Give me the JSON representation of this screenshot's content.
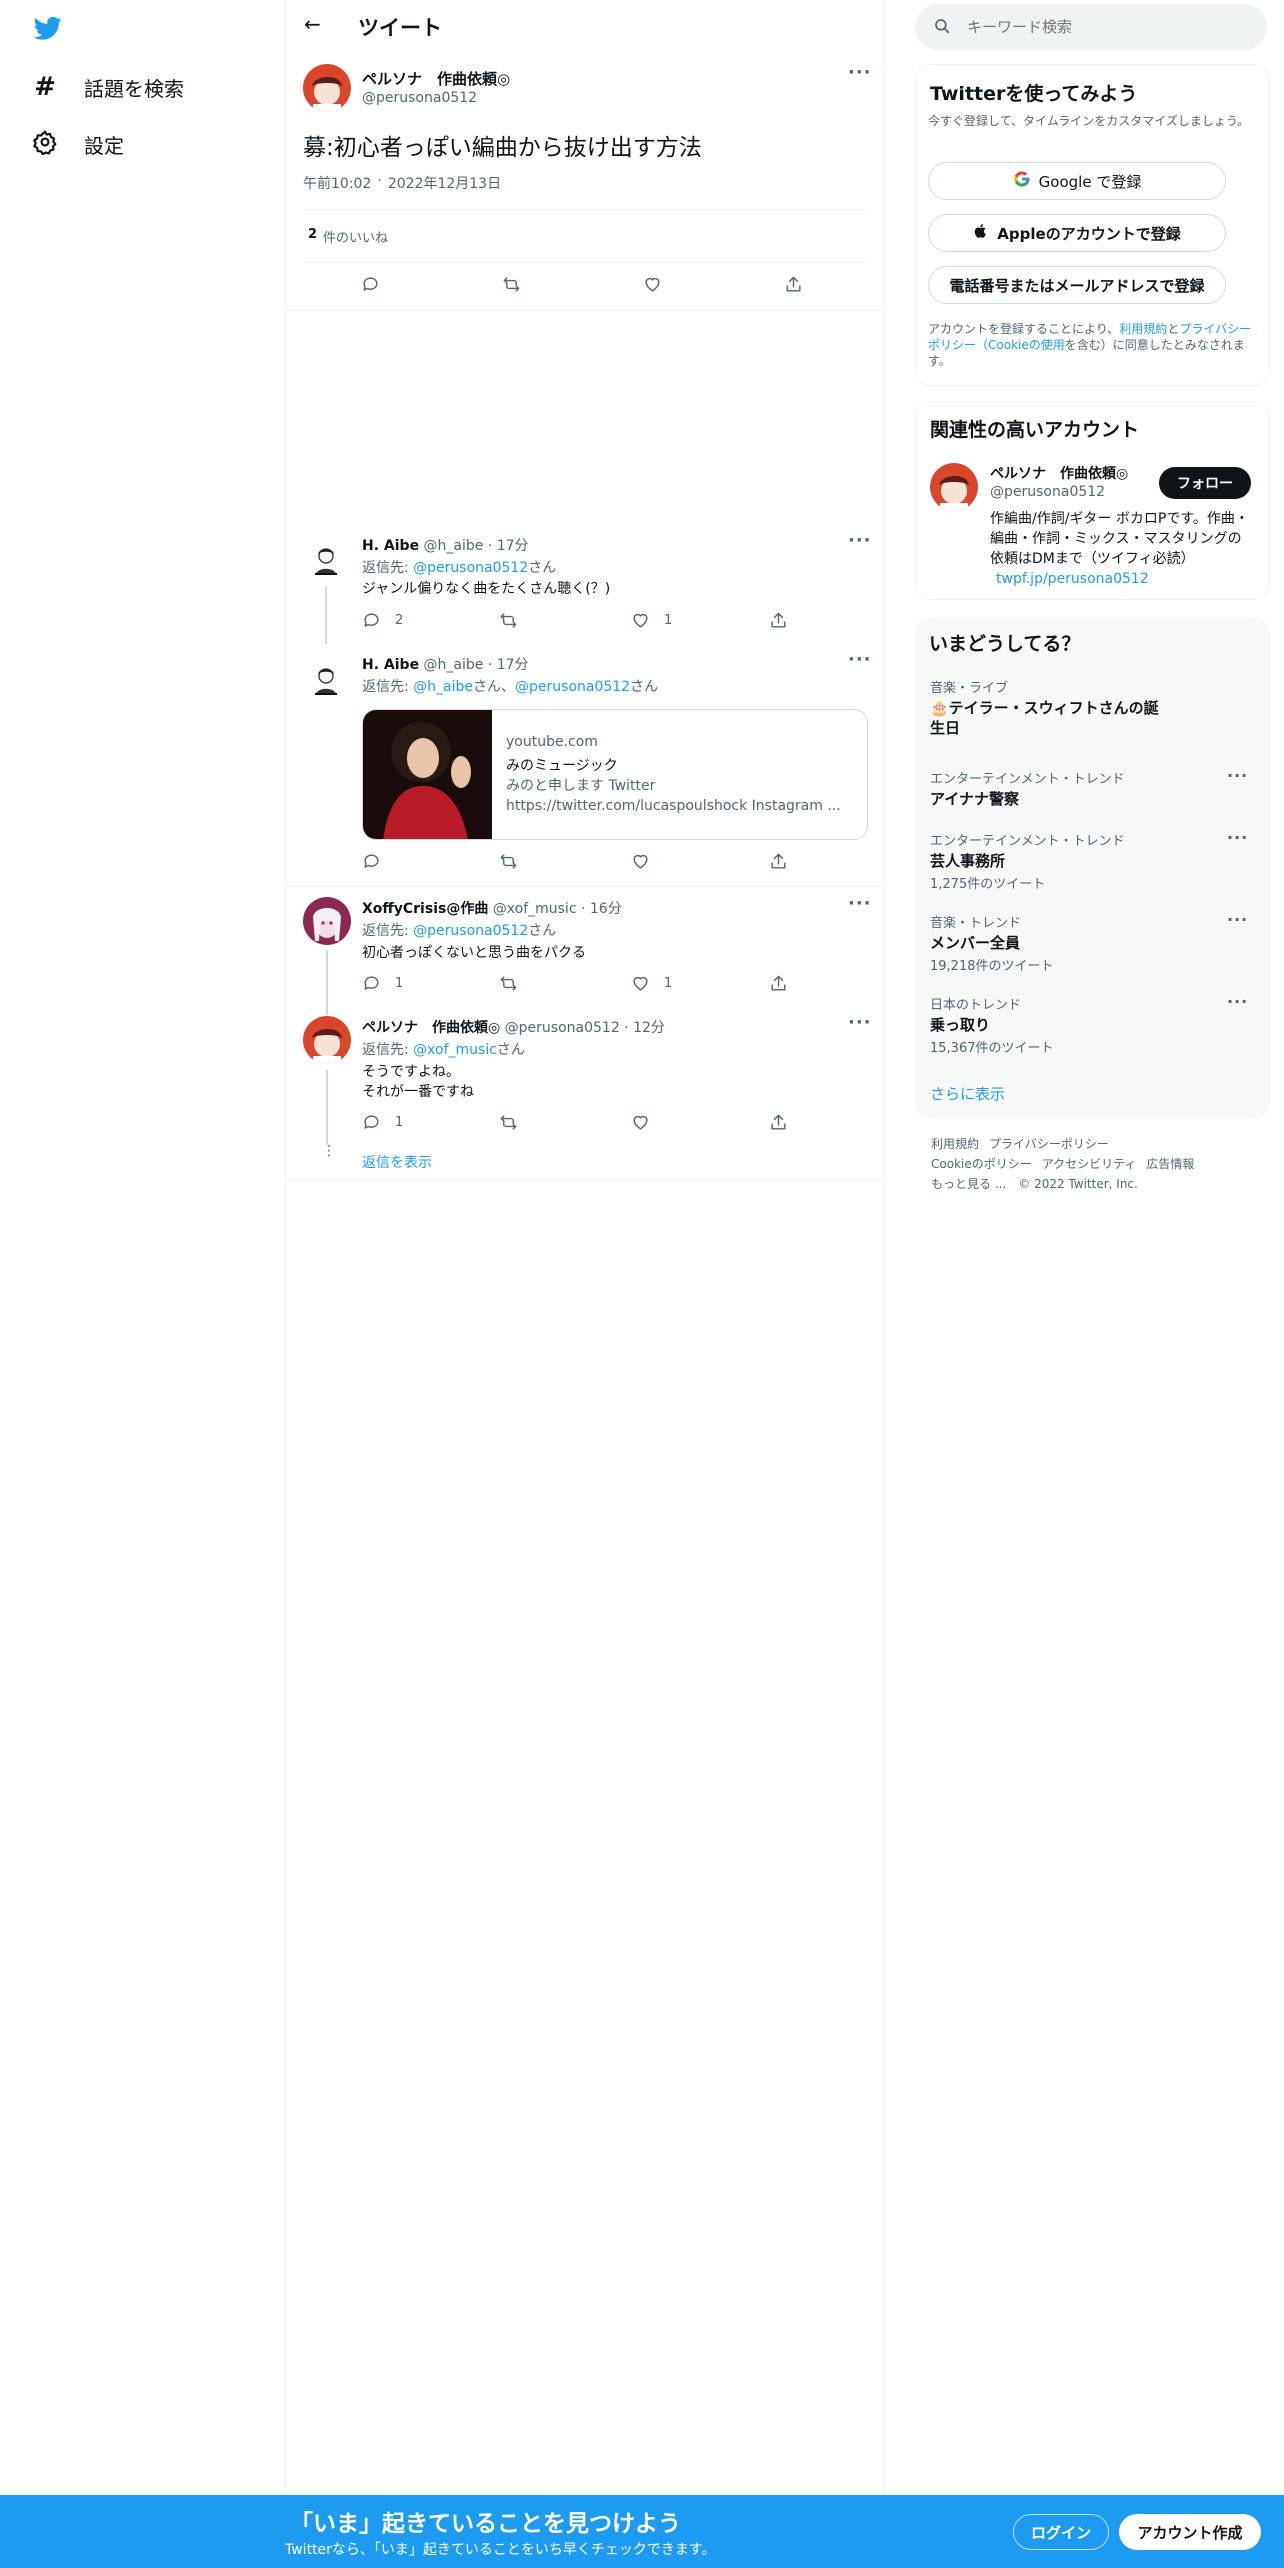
{
  "header": {
    "title": "ツイート",
    "back": "←"
  },
  "nav": {
    "items": [
      {
        "label": "話題を検索"
      },
      {
        "label": "設定"
      }
    ]
  },
  "search": {
    "placeholder": "キーワード検索"
  },
  "main_tweet": {
    "name": "ペルソナ　作曲依頼◎",
    "handle": "@perusona0512",
    "text": "募:初心者っぽい編曲から抜け出す方法",
    "time": "午前10:02",
    "sep": "·",
    "date": "2022年12月13日",
    "likes_count": "2",
    "likes_label": "件のいいね"
  },
  "replies": [
    {
      "name": "H. Aibe",
      "handle": "@h_aibe",
      "time": "· 17分",
      "reply_prefix": "返信先: ",
      "reply_to": "@perusona0512",
      "reply_suffix": "さん",
      "text": "ジャンル偏りなく曲をたくさん聴く(？)",
      "reply_count": "2",
      "retweet_count": "",
      "like_count": "1"
    },
    {
      "name": "H. Aibe",
      "handle": "@h_aibe",
      "time": "· 17分",
      "reply_prefix": "返信先: ",
      "reply_to": "@h_aibe",
      "reply_mid": "さん、",
      "reply_to2": "@perusona0512",
      "reply_suffix": "さん",
      "card": {
        "domain": "youtube.com",
        "title": "みのミュージック",
        "desc": "みのと申します Twitter https://twitter.com/lucaspoulshock Instagram ..."
      },
      "reply_count": "",
      "retweet_count": "",
      "like_count": ""
    },
    {
      "name": "XoffyCrisis@作曲",
      "handle": "@xof_music",
      "time": "· 16分",
      "reply_prefix": "返信先: ",
      "reply_to": "@perusona0512",
      "reply_suffix": "さん",
      "text": "初心者っぽくないと思う曲をパクる",
      "reply_count": "1",
      "retweet_count": "",
      "like_count": "1"
    },
    {
      "name": "ペルソナ　作曲依頼◎",
      "handle": "@perusona0512",
      "time": "· 12分",
      "reply_prefix": "返信先: ",
      "reply_to": "@xof_music",
      "reply_suffix": "さん",
      "text_line1": "そうですよね。",
      "text_line2": "それが一番ですね",
      "reply_count": "1",
      "retweet_count": "",
      "like_count": ""
    }
  ],
  "show_replies": "返信を表示",
  "signup": {
    "title": "Twitterを使ってみよう",
    "subtitle": "今すぐ登録して、タイムラインをカスタマイズしましょう。",
    "google": "Google で登録",
    "apple": "Appleのアカウントで登録",
    "phone": "電話番号またはメールアドレスで登録",
    "terms_1": "アカウントを登録することにより、",
    "terms_link1": "利用規約",
    "terms_2": "と",
    "terms_link2": "プライバシーポリシー（Cookieの使用",
    "terms_3": "を含む）に同意したとみなされます。"
  },
  "related": {
    "title": "関連性の高いアカウント",
    "name": "ペルソナ　作曲依頼◎",
    "handle": "@perusona0512",
    "follow": "フォロー",
    "bio": "作編曲/作詞/ギター ボカロPです。作曲・編曲・作詞・ミックス・マスタリングの依頼はDMまで（ツイフィ必読）",
    "bio_link": "twpf.jp/perusona0512"
  },
  "trends": {
    "title": "いまどうしてる？",
    "items": [
      {
        "category": "音楽・ライブ",
        "title_line1": "🎂テイラー・スウィフトさんの誕",
        "title_line2": "生日",
        "count": ""
      },
      {
        "category": "エンターテインメント・トレンド",
        "title_line1": "アイナナ警察",
        "title_line2": "",
        "count": ""
      },
      {
        "category": "エンターテインメント・トレンド",
        "title_line1": "芸人事務所",
        "title_line2": "",
        "count": "1,275件のツイート"
      },
      {
        "category": "音楽・トレンド",
        "title_line1": "メンバー全員",
        "title_line2": "",
        "count": "19,218件のツイート"
      },
      {
        "category": "日本のトレンド",
        "title_line1": "乗っ取り",
        "title_line2": "",
        "count": "15,367件のツイート"
      }
    ],
    "show_more": "さらに表示"
  },
  "footer": {
    "links": [
      "利用規約",
      "プライバシーポリシー",
      "Cookieのポリシー",
      "アクセシビリティ",
      "広告情報",
      "もっと見る ..."
    ],
    "copyright": "© 2022 Twitter, Inc."
  },
  "bottom_bar": {
    "title": "「いま」起きていることを見つけよう",
    "subtitle": "Twitterなら、「いま」起きていることをいち早くチェックできます。",
    "login": "ログイン",
    "signup": "アカウント作成"
  },
  "colors": {
    "accent": "#1d9bf0",
    "text": "#0f1419",
    "muted": "#536471",
    "border": "#eff3f4"
  }
}
